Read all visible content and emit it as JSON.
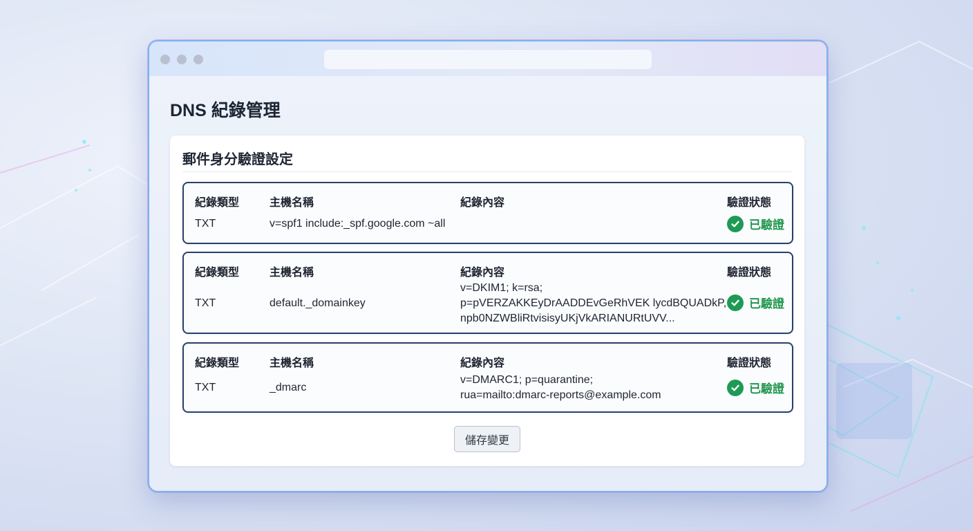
{
  "page": {
    "title": "DNS 紀錄管理"
  },
  "section": {
    "title": "郵件身分驗證設定"
  },
  "columns": {
    "type": "紀錄類型",
    "host": "主機名稱",
    "content": "紀錄內容",
    "status": "驗證狀態"
  },
  "records": [
    {
      "type": "TXT",
      "host": "v=spf1 include:_spf.google.com ~all",
      "content": [],
      "status": "已驗證"
    },
    {
      "type": "TXT",
      "host": "default._domainkey",
      "content": [
        "v=DKIM1; k=rsa;",
        "p=pVERZAKKEyDrAADDEvGeRhVEK lycdBQUADkP,",
        "npb0NZWBliRtvisisyUKjVkARIANURtUVV..."
      ],
      "status": "已驗證"
    },
    {
      "type": "TXT",
      "host": "_dmarc",
      "content": [
        "v=DMARC1; p=quarantine;",
        "rua=mailto:dmarc-reports@example.com"
      ],
      "status": "已驗證"
    }
  ],
  "actions": {
    "save_label": "儲存變更"
  },
  "icons": {
    "status": "check-circle-icon"
  },
  "colors": {
    "verified": "#23974f",
    "record_border": "#27406d"
  }
}
